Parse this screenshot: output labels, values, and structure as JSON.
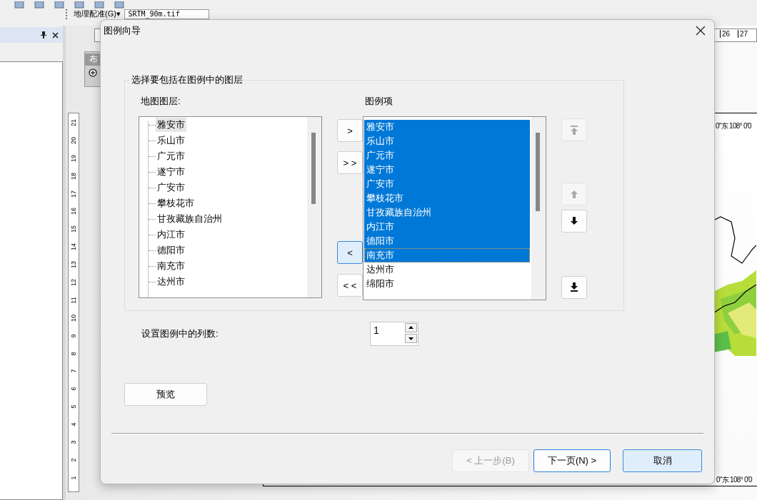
{
  "toolbar": {
    "menu": "地理配准(G)▾",
    "raster_layer": "SRTM_90m.tif"
  },
  "layout": {
    "toolbar_title": "布",
    "vertical_ruler": [
      "21",
      "20",
      "19",
      "18",
      "17",
      "16",
      "15",
      "14",
      "13",
      "12",
      "11",
      "10",
      "9",
      "8",
      "7",
      "6",
      "5",
      "4",
      "3",
      "2",
      "1"
    ],
    "top_ruler": [
      "26",
      "27"
    ],
    "graticule_top": "0″东  108° 0′0",
    "graticule_bottom": "0″东 108° 0′0"
  },
  "dialog": {
    "title": "图例向导",
    "group_title": "选择要包括在图例中的图层",
    "map_layers_label": "地图图层:",
    "map_layers": [
      {
        "label": "雅安市",
        "selected": true
      },
      {
        "label": "乐山市",
        "selected": false
      },
      {
        "label": "广元市",
        "selected": false
      },
      {
        "label": "遂宁市",
        "selected": false
      },
      {
        "label": "广安市",
        "selected": false
      },
      {
        "label": "攀枝花市",
        "selected": false
      },
      {
        "label": "甘孜藏族自治州",
        "selected": false
      },
      {
        "label": "内江市",
        "selected": false
      },
      {
        "label": "德阳市",
        "selected": false
      },
      {
        "label": "南充市",
        "selected": false
      },
      {
        "label": "达州市",
        "selected": false
      }
    ],
    "legend_items_label": "图例项",
    "legend_items": [
      {
        "label": "雅安市",
        "selected": true,
        "focused": false
      },
      {
        "label": "乐山市",
        "selected": true,
        "focused": false
      },
      {
        "label": "广元市",
        "selected": true,
        "focused": false
      },
      {
        "label": "遂宁市",
        "selected": true,
        "focused": false
      },
      {
        "label": "广安市",
        "selected": true,
        "focused": false
      },
      {
        "label": "攀枝花市",
        "selected": true,
        "focused": false
      },
      {
        "label": "甘孜藏族自治州",
        "selected": true,
        "focused": false
      },
      {
        "label": "内江市",
        "selected": true,
        "focused": false
      },
      {
        "label": "德阳市",
        "selected": true,
        "focused": false
      },
      {
        "label": "南充市",
        "selected": true,
        "focused": true
      },
      {
        "label": "达州市",
        "selected": false,
        "focused": false
      },
      {
        "label": "绵阳市",
        "selected": false,
        "focused": false
      }
    ],
    "move_buttons": [
      {
        "label": ">",
        "highlighted": false
      },
      {
        "label": "> >",
        "highlighted": false
      },
      {
        "label": "<",
        "highlighted": true
      },
      {
        "label": "< <",
        "highlighted": false
      }
    ],
    "order_buttons": [
      {
        "kind": "top",
        "disabled": true
      },
      {
        "kind": "up",
        "disabled": true
      },
      {
        "kind": "down",
        "disabled": false
      },
      {
        "kind": "bottom",
        "disabled": false
      }
    ],
    "columns_label": "设置图例中的列数:",
    "columns_value": "1",
    "preview_button": "预览",
    "footer_buttons": [
      {
        "label": "< 上一步(B)",
        "disabled": true,
        "default": false,
        "highlighted": false
      },
      {
        "label": "下一页(N) >",
        "disabled": false,
        "default": true,
        "highlighted": false
      },
      {
        "label": "取消",
        "disabled": false,
        "default": false,
        "highlighted": true
      }
    ]
  }
}
